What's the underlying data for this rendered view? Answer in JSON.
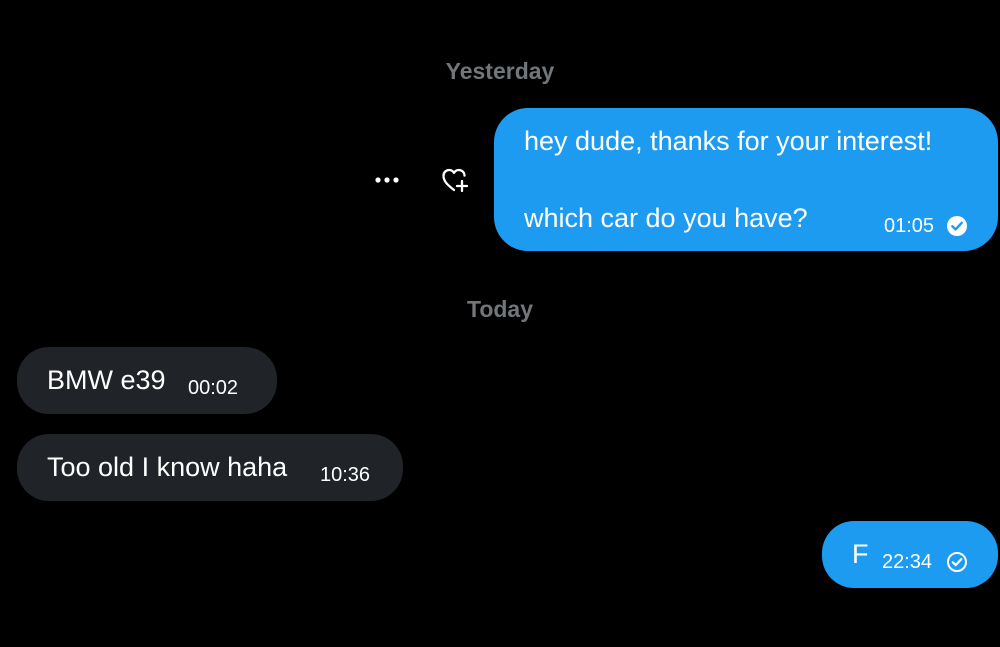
{
  "conversation": {
    "separators": {
      "yesterday": "Yesterday",
      "today": "Today"
    },
    "messages": [
      {
        "direction": "outgoing",
        "lines": [
          "hey dude, thanks for your interest!",
          "which car do you have?"
        ],
        "time": "01:05",
        "status": "read",
        "status_icon": "check-circle-filled-icon"
      },
      {
        "direction": "incoming",
        "text": "BMW e39",
        "time": "00:02"
      },
      {
        "direction": "incoming",
        "text": "Too old I know haha",
        "time": "10:36"
      },
      {
        "direction": "outgoing",
        "text": "F",
        "time": "22:34",
        "status": "sent",
        "status_icon": "check-circle-outline-icon"
      }
    ],
    "message_actions": {
      "more_icon": "more-horizontal-icon",
      "react_icon": "heart-plus-icon"
    }
  },
  "colors": {
    "background": "#000000",
    "outgoing_bubble": "#1d9bf0",
    "incoming_bubble": "#202327",
    "separator_text": "#71767b",
    "text": "#ffffff"
  }
}
